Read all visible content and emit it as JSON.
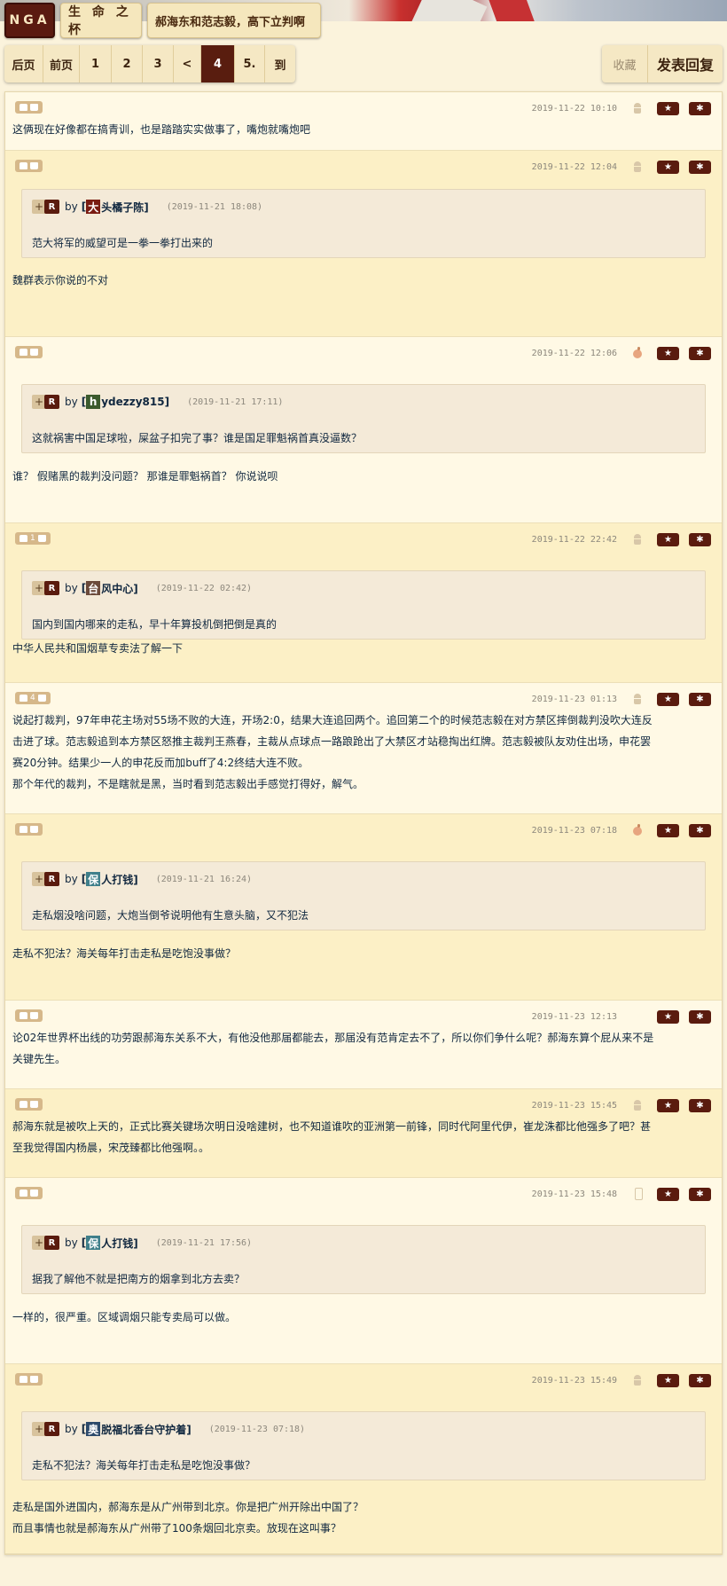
{
  "header": {
    "logo": "NGA",
    "forum": "生 命 之 杯",
    "topic": "郝海东和范志毅，高下立判啊"
  },
  "pager": {
    "items": [
      "后页",
      "前页",
      "1",
      "2",
      "3",
      "<",
      "4",
      "5.",
      "到"
    ],
    "active": "4",
    "favorite": "收藏",
    "reply": "发表回复"
  },
  "colors": {
    "page_bg": "#fbf3dc",
    "post_odd": "#fff9e5",
    "post_even": "#fcf0c6",
    "accent": "#5a1b0e",
    "text": "#10273f"
  },
  "posts": [
    {
      "vote": "",
      "date": "2019-11-22 10:10",
      "device": "android-icon",
      "text_lines": [
        "这俩现在好像都在搞青训，也是踏踏实实做事了，嘴炮就嘴炮吧"
      ]
    },
    {
      "vote": "",
      "date": "2019-11-22 12:04",
      "device": "android-icon",
      "quote": {
        "user_avatar": "大",
        "user_rest": "头橘子陈]",
        "time": "(2019-11-21 18:08)",
        "text": "范大将军的威望可是一拳一拳打出来的"
      },
      "text_lines": [
        "魏群表示你说的不对"
      ]
    },
    {
      "vote": "",
      "date": "2019-11-22 12:06",
      "device": "apple-icon",
      "quote": {
        "user_avatar": "h",
        "user_rest": "ydezzy815]",
        "time": "(2019-11-21 17:11)",
        "text": "这就祸害中国足球啦，屎盆子扣完了事？谁是国足罪魁祸首真没逼数？"
      },
      "text_lines": [
        "谁？ 假赌黑的裁判没问题？ 那谁是罪魁祸首？ 你说说呗"
      ]
    },
    {
      "vote": "1",
      "date": "2019-11-22 22:42",
      "device": "android-icon",
      "quote": {
        "user_avatar": "台",
        "user_rest": "风中心]",
        "time": "(2019-11-22 02:42)",
        "text": "国内到国内哪来的走私，早十年算投机倒把倒是真的"
      },
      "text_lines": [
        "中华人民共和国烟草专卖法了解一下"
      ]
    },
    {
      "vote": "4",
      "date": "2019-11-23 01:13",
      "device": "android-icon",
      "text_lines": [
        "说起打裁判，97年申花主场对55场不败的大连，开场2:0，结果大连追回两个。追回第二个的时候范志毅在对方禁区摔倒裁判没吹大连反",
        "击进了球。范志毅追到本方禁区怒推主裁判王燕春，主裁从点球点一路踉跄出了大禁区才站稳掏出红牌。范志毅被队友劝住出场，申花罢",
        "赛20分钟。结果少一人的申花反而加buff了4:2终结大连不败。",
        "那个年代的裁判，不是瞎就是黑，当时看到范志毅出手感觉打得好，解气。"
      ]
    },
    {
      "vote": "",
      "date": "2019-11-23 07:18",
      "device": "apple-icon",
      "quote": {
        "user_avatar": "保",
        "user_rest": "人打钱]",
        "time": "(2019-11-21 16:24)",
        "text": "走私烟没啥问题，大炮当倒爷说明他有生意头脑，又不犯法"
      },
      "text_lines": [
        "走私不犯法？海关每年打击走私是吃饱没事做？"
      ]
    },
    {
      "vote": "",
      "date": "2019-11-23 12:13",
      "device": "",
      "text_lines": [
        "论02年世界杯出线的功劳跟郝海东关系不大，有他没他那届都能去，那届没有范肯定去不了，所以你们争什么呢？郝海东算个屁从来不是",
        "关键先生。"
      ]
    },
    {
      "vote": "",
      "date": "2019-11-23 15:45",
      "device": "android-icon",
      "text_lines": [
        "郝海东就是被吹上天的，正式比赛关键场次明日没啥建树，也不知道谁吹的亚洲第一前锋，同时代阿里代伊，崔龙洙都比他强多了吧？甚",
        "至我觉得国内杨晨，宋茂臻都比他强啊。。"
      ]
    },
    {
      "vote": "",
      "date": "2019-11-23 15:48",
      "device": "phone-icon",
      "quote": {
        "user_avatar": "保",
        "user_rest": "人打钱]",
        "time": "(2019-11-21 17:56)",
        "text": "据我了解他不就是把南方的烟拿到北方去卖？"
      },
      "text_lines": [
        "一样的，很严重。区域调烟只能专卖局可以做。"
      ]
    },
    {
      "vote": "",
      "date": "2019-11-23 15:49",
      "device": "android-icon",
      "quote": {
        "user_avatar": "奥",
        "user_rest": "脱福北香台守护着]",
        "time": "(2019-11-23 07:18)",
        "text": "走私不犯法？海关每年打击走私是吃饱没事做？"
      },
      "text_lines": [
        "走私是国外进国内，郝海东是从广州带到北京。你是把广州开除出中国了？",
        "而且事情也就是郝海东从广州带了100条烟回北京卖。放现在这叫事？"
      ]
    }
  ],
  "quote_by": "by",
  "quote_r": "R",
  "quote_plus": "+",
  "icons": {
    "vote_up": "thumb-up-icon",
    "vote_down": "thumb-down-icon",
    "star": "star-icon",
    "gear": "gear-icon"
  }
}
